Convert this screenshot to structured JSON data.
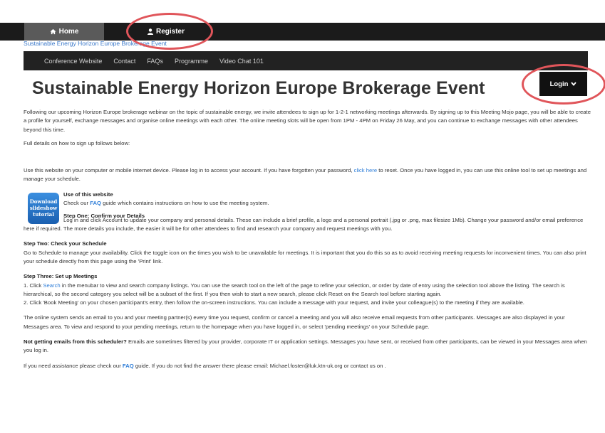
{
  "nav": {
    "home": "Home",
    "register": "Register"
  },
  "breadcrumb": "Sustainable Energy Horizon Europe Brokerage Event",
  "subnav": [
    "Conference Website",
    "Contact",
    "FAQs",
    "Programme",
    "Video Chat 101"
  ],
  "title": "Sustainable Energy Horizon Europe Brokerage Event",
  "login": "Login",
  "accent": "#2f7ed8",
  "annotation_color": "#e0555a",
  "body": {
    "intro": "Following our upcoming Horizon Europe brokerage webinar on the topic of sustainable energy, we invite attendees to sign up for 1-2-1 networking meetings afterwards. By signing up to this Meeting Mojo page, you will be able to create a profile for yourself, exchange messages and organise online meetings with each other. The online meeting slots will be open from 1PM - 4PM on Friday 26 May, and you can continue to exchange messages with other attendees beyond this time.",
    "full_details": "Full details on how to sign up follows below:",
    "login_info_1": "Use this website on your computer or mobile internet device. Please log in to access your account. If you have forgotten your password,",
    "click_here": "click here",
    "login_info_2": "to reset. Once you have logged in, you can use this online tool to set up meetings and manage your schedule.",
    "slideshow": "Download slideshow tutorial",
    "use_heading": "Use of this website",
    "use_text_1": "Check our",
    "faq": "FAQ",
    "use_text_2": "guide which contains instructions on how to use the meeting system.",
    "step1_heading": "Step One: Confirm your Details",
    "step1_text": "Log in and click Account to update your company and personal details. These can include a brief profile, a logo and a personal portrait (.jpg or .png, max filesize 1Mb). Change your password and/or email preference here if required. The more details you include, the easier it will be for other attendees to find and research your company and request meetings with you.",
    "step2_heading": "Step Two: Check your Schedule",
    "step2_text": "Go to Schedule to manage your availability. Click the toggle icon on the times you wish to be unavailable for meetings. It is important that you do this so as to avoid receiving meeting requests for inconvenient times. You can also print your schedule directly from this page using the 'Print' link.",
    "step3_heading": "Step Three: Set up Meetings",
    "step3_1a": "1. Click",
    "search": "Search",
    "step3_1b": "in the menubar to view and search company listings. You can use the search tool on the left of the page to refine your selection, or order by date of entry using the selection tool above the listing. The search is hierarchical, so the second category you select will be a subset of the first. If you then wish to start a new search, please click Reset on the Search tool before starting again.",
    "step3_2": "2. Click 'Book Meeting' on your chosen participant's entry, then follow the on-screen instructions. You can include a message with your request, and invite your colleague(s) to the meeting if they are available.",
    "online_system": "The online system sends an email to you and your meeting partner(s) every time you request, confirm or cancel a meeting and you will also receive email requests from other participants. Messages are also displayed in your Messages area. To view and respond to your pending meetings, return to the homepage when you have logged in, or select 'pending meetings' on your Schedule page.",
    "not_getting_bold": "Not getting emails from this scheduler?",
    "not_getting_text": "Emails are sometimes filtered by your provider, corporate IT or application settings. Messages you have sent, or received from other participants, can be viewed in your Messages area when you log in.",
    "assist_1": "If you need assistance please check our",
    "assist_2": "guide. If you do not find the answer there please email: Michael.foster@luk.ktn-uk.org or contact us on ."
  }
}
